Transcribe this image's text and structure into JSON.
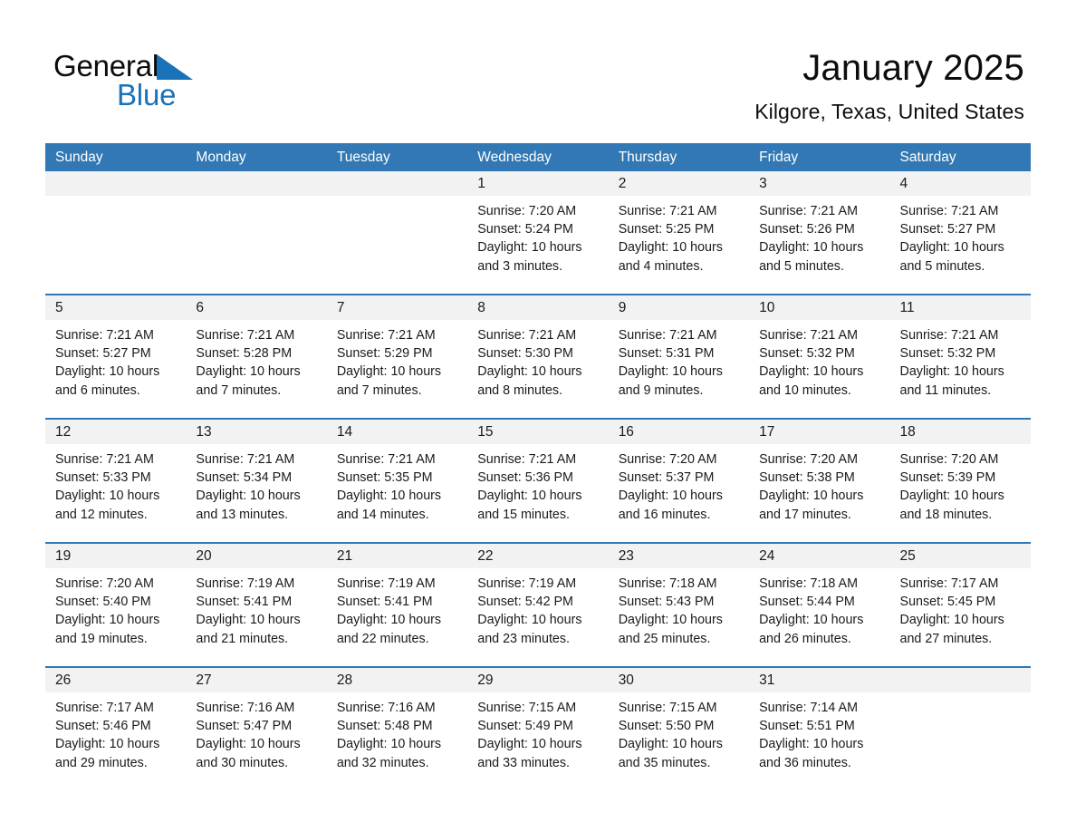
{
  "brand": {
    "name_part1": "General",
    "name_part2": "Blue",
    "color_blue": "#1a72b8",
    "triangle_icon": "triangle-right-icon"
  },
  "header": {
    "month_title": "January 2025",
    "location": "Kilgore, Texas, United States"
  },
  "calendar": {
    "header_bg": "#3178b4",
    "daynum_bg": "#f2f2f2",
    "day_names": [
      "Sunday",
      "Monday",
      "Tuesday",
      "Wednesday",
      "Thursday",
      "Friday",
      "Saturday"
    ],
    "weeks": [
      {
        "days": [
          {
            "num": "",
            "lines": []
          },
          {
            "num": "",
            "lines": []
          },
          {
            "num": "",
            "lines": []
          },
          {
            "num": "1",
            "lines": [
              "Sunrise: 7:20 AM",
              "Sunset: 5:24 PM",
              "Daylight: 10 hours",
              "and 3 minutes."
            ]
          },
          {
            "num": "2",
            "lines": [
              "Sunrise: 7:21 AM",
              "Sunset: 5:25 PM",
              "Daylight: 10 hours",
              "and 4 minutes."
            ]
          },
          {
            "num": "3",
            "lines": [
              "Sunrise: 7:21 AM",
              "Sunset: 5:26 PM",
              "Daylight: 10 hours",
              "and 5 minutes."
            ]
          },
          {
            "num": "4",
            "lines": [
              "Sunrise: 7:21 AM",
              "Sunset: 5:27 PM",
              "Daylight: 10 hours",
              "and 5 minutes."
            ]
          }
        ]
      },
      {
        "days": [
          {
            "num": "5",
            "lines": [
              "Sunrise: 7:21 AM",
              "Sunset: 5:27 PM",
              "Daylight: 10 hours",
              "and 6 minutes."
            ]
          },
          {
            "num": "6",
            "lines": [
              "Sunrise: 7:21 AM",
              "Sunset: 5:28 PM",
              "Daylight: 10 hours",
              "and 7 minutes."
            ]
          },
          {
            "num": "7",
            "lines": [
              "Sunrise: 7:21 AM",
              "Sunset: 5:29 PM",
              "Daylight: 10 hours",
              "and 7 minutes."
            ]
          },
          {
            "num": "8",
            "lines": [
              "Sunrise: 7:21 AM",
              "Sunset: 5:30 PM",
              "Daylight: 10 hours",
              "and 8 minutes."
            ]
          },
          {
            "num": "9",
            "lines": [
              "Sunrise: 7:21 AM",
              "Sunset: 5:31 PM",
              "Daylight: 10 hours",
              "and 9 minutes."
            ]
          },
          {
            "num": "10",
            "lines": [
              "Sunrise: 7:21 AM",
              "Sunset: 5:32 PM",
              "Daylight: 10 hours",
              "and 10 minutes."
            ]
          },
          {
            "num": "11",
            "lines": [
              "Sunrise: 7:21 AM",
              "Sunset: 5:32 PM",
              "Daylight: 10 hours",
              "and 11 minutes."
            ]
          }
        ]
      },
      {
        "days": [
          {
            "num": "12",
            "lines": [
              "Sunrise: 7:21 AM",
              "Sunset: 5:33 PM",
              "Daylight: 10 hours",
              "and 12 minutes."
            ]
          },
          {
            "num": "13",
            "lines": [
              "Sunrise: 7:21 AM",
              "Sunset: 5:34 PM",
              "Daylight: 10 hours",
              "and 13 minutes."
            ]
          },
          {
            "num": "14",
            "lines": [
              "Sunrise: 7:21 AM",
              "Sunset: 5:35 PM",
              "Daylight: 10 hours",
              "and 14 minutes."
            ]
          },
          {
            "num": "15",
            "lines": [
              "Sunrise: 7:21 AM",
              "Sunset: 5:36 PM",
              "Daylight: 10 hours",
              "and 15 minutes."
            ]
          },
          {
            "num": "16",
            "lines": [
              "Sunrise: 7:20 AM",
              "Sunset: 5:37 PM",
              "Daylight: 10 hours",
              "and 16 minutes."
            ]
          },
          {
            "num": "17",
            "lines": [
              "Sunrise: 7:20 AM",
              "Sunset: 5:38 PM",
              "Daylight: 10 hours",
              "and 17 minutes."
            ]
          },
          {
            "num": "18",
            "lines": [
              "Sunrise: 7:20 AM",
              "Sunset: 5:39 PM",
              "Daylight: 10 hours",
              "and 18 minutes."
            ]
          }
        ]
      },
      {
        "days": [
          {
            "num": "19",
            "lines": [
              "Sunrise: 7:20 AM",
              "Sunset: 5:40 PM",
              "Daylight: 10 hours",
              "and 19 minutes."
            ]
          },
          {
            "num": "20",
            "lines": [
              "Sunrise: 7:19 AM",
              "Sunset: 5:41 PM",
              "Daylight: 10 hours",
              "and 21 minutes."
            ]
          },
          {
            "num": "21",
            "lines": [
              "Sunrise: 7:19 AM",
              "Sunset: 5:41 PM",
              "Daylight: 10 hours",
              "and 22 minutes."
            ]
          },
          {
            "num": "22",
            "lines": [
              "Sunrise: 7:19 AM",
              "Sunset: 5:42 PM",
              "Daylight: 10 hours",
              "and 23 minutes."
            ]
          },
          {
            "num": "23",
            "lines": [
              "Sunrise: 7:18 AM",
              "Sunset: 5:43 PM",
              "Daylight: 10 hours",
              "and 25 minutes."
            ]
          },
          {
            "num": "24",
            "lines": [
              "Sunrise: 7:18 AM",
              "Sunset: 5:44 PM",
              "Daylight: 10 hours",
              "and 26 minutes."
            ]
          },
          {
            "num": "25",
            "lines": [
              "Sunrise: 7:17 AM",
              "Sunset: 5:45 PM",
              "Daylight: 10 hours",
              "and 27 minutes."
            ]
          }
        ]
      },
      {
        "days": [
          {
            "num": "26",
            "lines": [
              "Sunrise: 7:17 AM",
              "Sunset: 5:46 PM",
              "Daylight: 10 hours",
              "and 29 minutes."
            ]
          },
          {
            "num": "27",
            "lines": [
              "Sunrise: 7:16 AM",
              "Sunset: 5:47 PM",
              "Daylight: 10 hours",
              "and 30 minutes."
            ]
          },
          {
            "num": "28",
            "lines": [
              "Sunrise: 7:16 AM",
              "Sunset: 5:48 PM",
              "Daylight: 10 hours",
              "and 32 minutes."
            ]
          },
          {
            "num": "29",
            "lines": [
              "Sunrise: 7:15 AM",
              "Sunset: 5:49 PM",
              "Daylight: 10 hours",
              "and 33 minutes."
            ]
          },
          {
            "num": "30",
            "lines": [
              "Sunrise: 7:15 AM",
              "Sunset: 5:50 PM",
              "Daylight: 10 hours",
              "and 35 minutes."
            ]
          },
          {
            "num": "31",
            "lines": [
              "Sunrise: 7:14 AM",
              "Sunset: 5:51 PM",
              "Daylight: 10 hours",
              "and 36 minutes."
            ]
          },
          {
            "num": "",
            "lines": []
          }
        ]
      }
    ]
  }
}
